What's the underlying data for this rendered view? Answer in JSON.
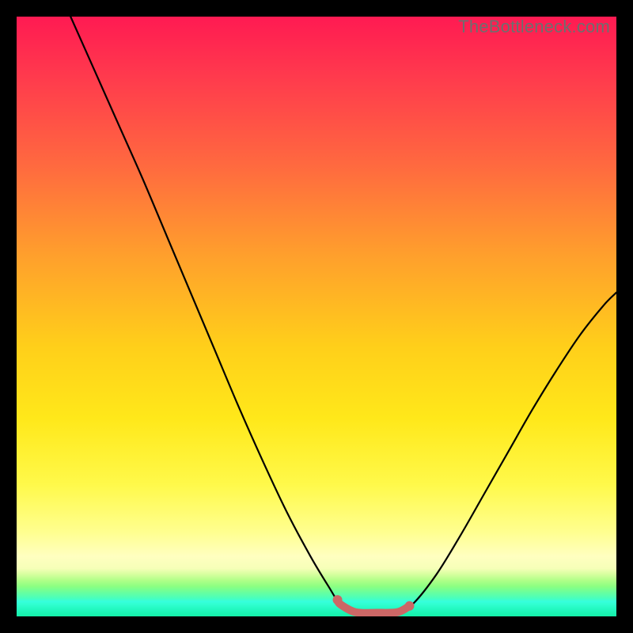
{
  "watermark": "TheBottleneck.com",
  "chart_data": {
    "type": "line",
    "title": "",
    "xlabel": "",
    "ylabel": "",
    "xlim": [
      0,
      100
    ],
    "ylim": [
      0,
      100
    ],
    "grid": false,
    "legend": false,
    "curve": {
      "color_main": "#000000",
      "color_accent": "#c86464",
      "points": [
        {
          "x": 9.0,
          "y": 100.0
        },
        {
          "x": 13.0,
          "y": 91.0
        },
        {
          "x": 17.0,
          "y": 82.0
        },
        {
          "x": 21.0,
          "y": 73.0
        },
        {
          "x": 25.0,
          "y": 63.5
        },
        {
          "x": 29.0,
          "y": 54.0
        },
        {
          "x": 33.0,
          "y": 44.5
        },
        {
          "x": 37.0,
          "y": 35.0
        },
        {
          "x": 41.0,
          "y": 26.0
        },
        {
          "x": 45.0,
          "y": 17.5
        },
        {
          "x": 49.0,
          "y": 10.0
        },
        {
          "x": 52.0,
          "y": 5.0
        },
        {
          "x": 54.0,
          "y": 2.0
        },
        {
          "x": 56.5,
          "y": 0.7
        },
        {
          "x": 60.0,
          "y": 0.6
        },
        {
          "x": 63.5,
          "y": 0.7
        },
        {
          "x": 66.0,
          "y": 2.0
        },
        {
          "x": 70.0,
          "y": 7.0
        },
        {
          "x": 74.0,
          "y": 13.5
        },
        {
          "x": 78.0,
          "y": 20.5
        },
        {
          "x": 82.0,
          "y": 27.5
        },
        {
          "x": 86.0,
          "y": 34.5
        },
        {
          "x": 90.0,
          "y": 41.0
        },
        {
          "x": 94.0,
          "y": 47.0
        },
        {
          "x": 98.0,
          "y": 52.0
        },
        {
          "x": 100.0,
          "y": 54.0
        }
      ],
      "accent_range_x": [
        53.5,
        65.5
      ]
    }
  }
}
